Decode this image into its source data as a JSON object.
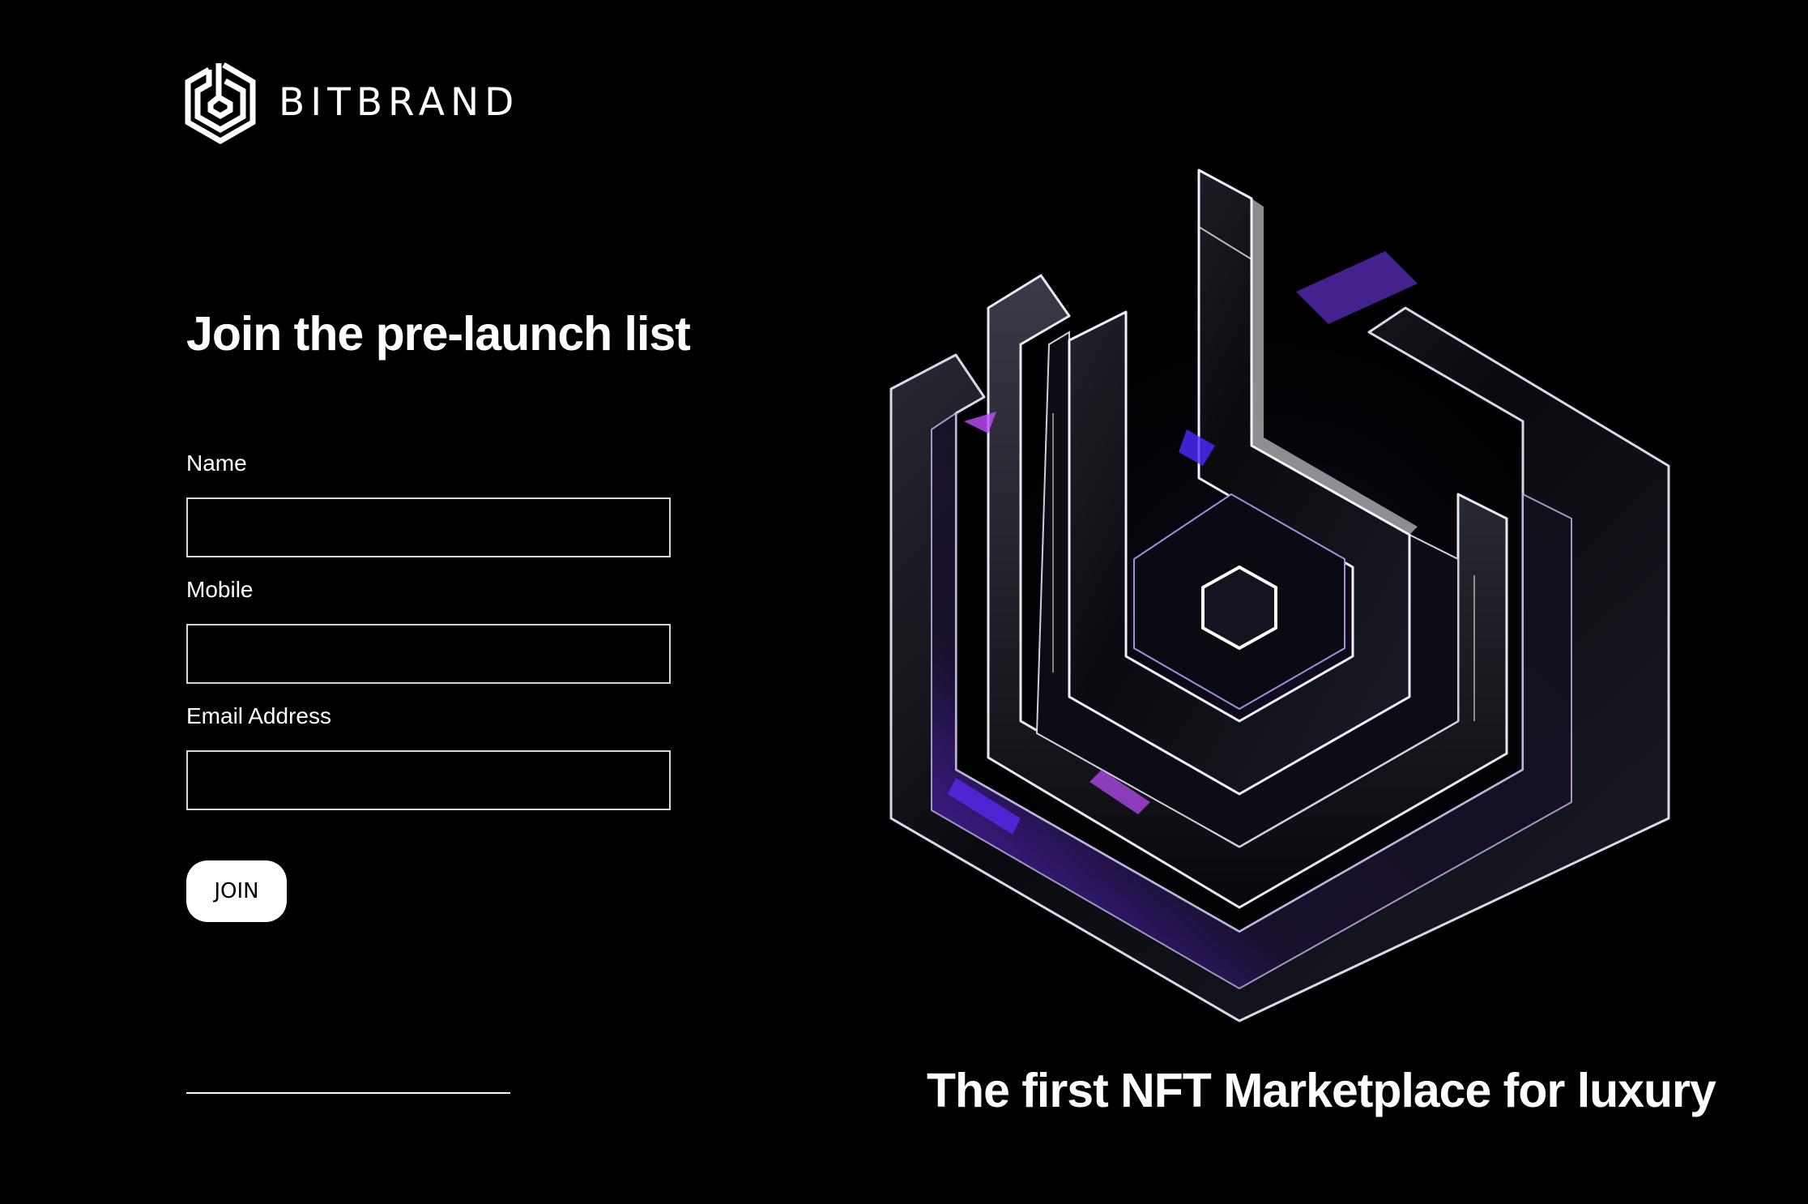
{
  "brand": {
    "name": "BITBRAND",
    "logo_icon": "hexagon-b-logo-icon"
  },
  "form": {
    "title": "Join the pre-launch list",
    "fields": [
      {
        "label": "Name",
        "value": "",
        "placeholder": ""
      },
      {
        "label": "Mobile",
        "value": "",
        "placeholder": ""
      },
      {
        "label": "Email Address",
        "value": "",
        "placeholder": ""
      }
    ],
    "submit_label": "JOIN"
  },
  "hero": {
    "image": "crystal-hexagon-b-logo-icon",
    "tagline": "The first NFT Marketplace for luxury"
  },
  "colors": {
    "background": "#000000",
    "text": "#ffffff",
    "input_border": "#d9d9d9",
    "button_bg": "#ffffff",
    "button_text": "#000000",
    "accent_purple": "#7b3cff"
  }
}
